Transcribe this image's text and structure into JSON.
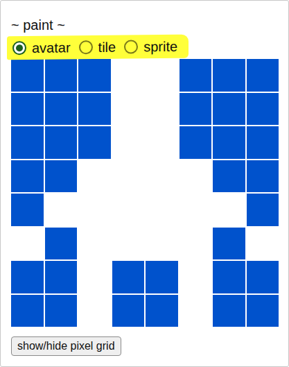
{
  "title": "~ paint ~",
  "modes": [
    {
      "label": "avatar",
      "selected": true
    },
    {
      "label": "tile",
      "selected": false
    },
    {
      "label": "sprite",
      "selected": false
    }
  ],
  "canvas": {
    "grid_visible": true,
    "pixels": [
      [
        true,
        true,
        true,
        false,
        false,
        true,
        true,
        true
      ],
      [
        true,
        true,
        true,
        false,
        false,
        true,
        true,
        true
      ],
      [
        true,
        true,
        true,
        false,
        false,
        true,
        true,
        true
      ],
      [
        true,
        true,
        false,
        false,
        false,
        false,
        true,
        true
      ],
      [
        true,
        false,
        false,
        false,
        false,
        false,
        false,
        true
      ],
      [
        false,
        true,
        false,
        false,
        false,
        false,
        true,
        false
      ],
      [
        true,
        true,
        false,
        true,
        true,
        false,
        true,
        true
      ],
      [
        true,
        true,
        false,
        true,
        true,
        false,
        true,
        true
      ]
    ]
  },
  "button": {
    "label": "show/hide pixel grid"
  }
}
